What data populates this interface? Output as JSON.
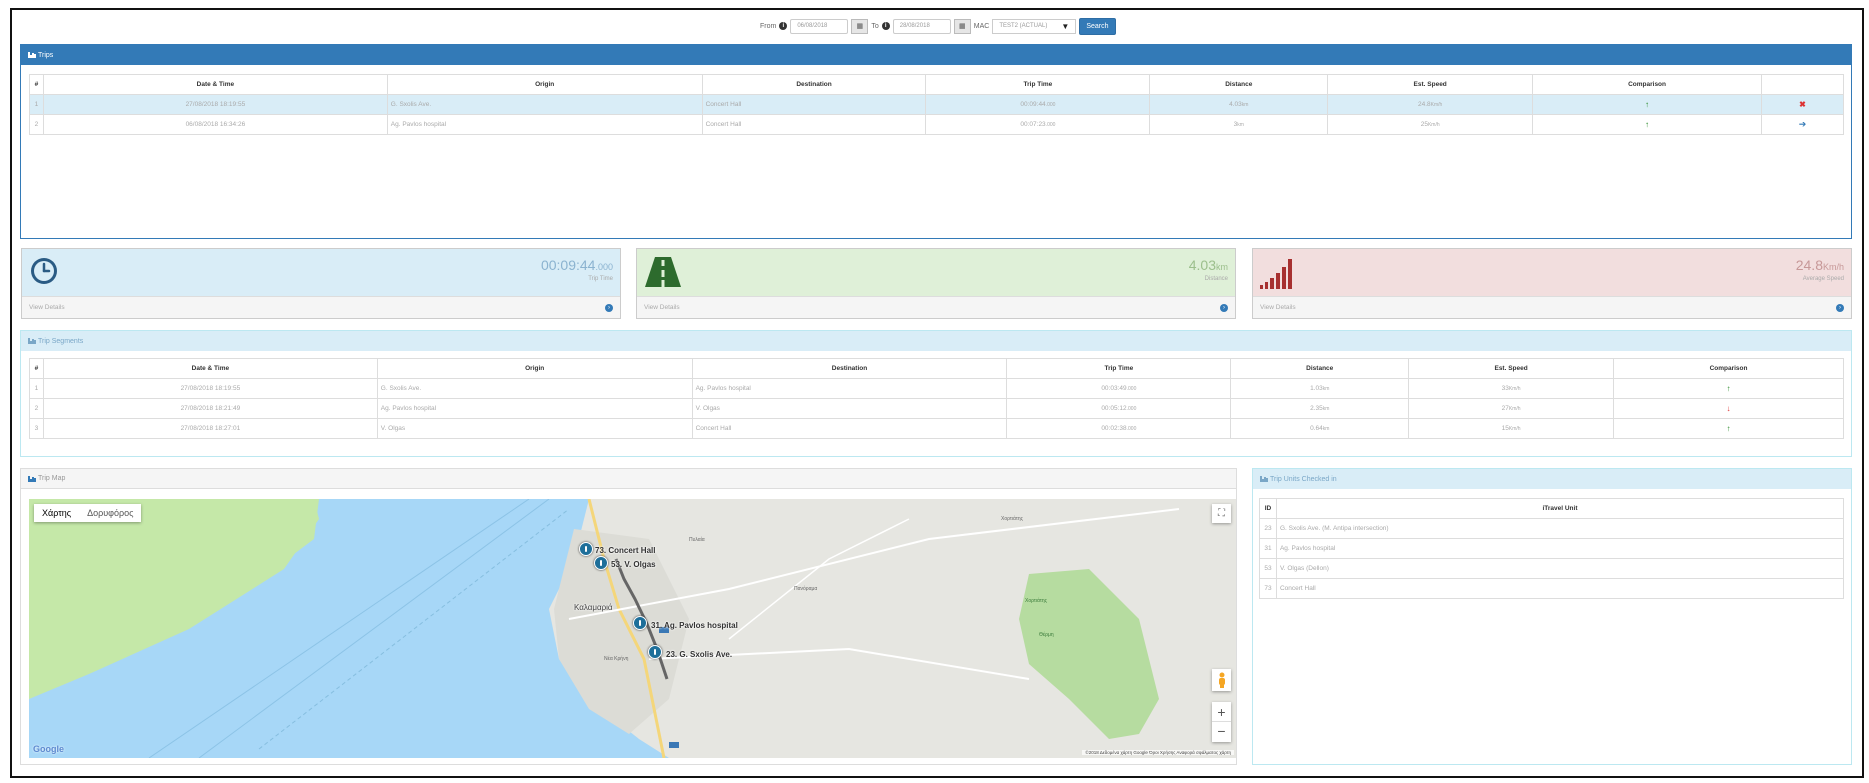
{
  "search": {
    "from_label": "From",
    "from_value": "06/08/2018",
    "to_label": "To",
    "to_value": "28/08/2018",
    "mac_label": "MAC",
    "mac_value": "TEST2 (ACTUAL)",
    "search_button": "Search"
  },
  "trips": {
    "title": "Trips",
    "headers": [
      "#",
      "Date & Time",
      "Origin",
      "Destination",
      "Trip Time",
      "Distance",
      "Est. Speed",
      "Comparison",
      ""
    ],
    "rows": [
      {
        "n": "1",
        "datetime": "27/08/2018 18:19:55",
        "origin": "G. Sxolis Ave.",
        "destination": "Concert Hall",
        "trip_time": "00:09:44",
        "trip_time_ms": ".000",
        "distance": "4.03",
        "distance_unit": "km",
        "speed": "24.8",
        "speed_unit": "Km/h",
        "comparison": "↑",
        "action": "✖"
      },
      {
        "n": "2",
        "datetime": "06/08/2018 16:34:26",
        "origin": "Ag. Pavlos hospital",
        "destination": "Concert Hall",
        "trip_time": "00:07:23",
        "trip_time_ms": ".000",
        "distance": "3",
        "distance_unit": "km",
        "speed": "25",
        "speed_unit": "Km/h",
        "comparison": "↑",
        "action": "➔"
      }
    ]
  },
  "stats": [
    {
      "value": "00:09:44",
      "value_unit": ".000",
      "label": "Trip Time",
      "footer": "View Details"
    },
    {
      "value": "4.03",
      "value_unit": "km",
      "label": "Distance",
      "footer": "View Details"
    },
    {
      "value": "24.8",
      "value_unit": "Km/h",
      "label": "Average Speed",
      "footer": "View Details"
    }
  ],
  "segments": {
    "title": "Trip Segments",
    "headers": [
      "#",
      "Date & Time",
      "Origin",
      "Destination",
      "Trip Time",
      "Distance",
      "Est. Speed",
      "Comparison"
    ],
    "rows": [
      {
        "n": "1",
        "datetime": "27/08/2018 18:19:55",
        "origin": "G. Sxolis Ave.",
        "destination": "Ag. Pavlos hospital",
        "trip_time": "00:03:49",
        "trip_time_ms": ".000",
        "distance": "1.03",
        "distance_unit": "km",
        "speed": "33",
        "speed_unit": "Km/h",
        "comparison": "↑"
      },
      {
        "n": "2",
        "datetime": "27/08/2018 18:21:49",
        "origin": "Ag. Pavlos hospital",
        "destination": "V. Olgas",
        "trip_time": "00:05:12",
        "trip_time_ms": ".000",
        "distance": "2.35",
        "distance_unit": "km",
        "speed": "27",
        "speed_unit": "Km/h",
        "comparison": "↓"
      },
      {
        "n": "3",
        "datetime": "27/08/2018 18:27:01",
        "origin": "V. Olgas",
        "destination": "Concert Hall",
        "trip_time": "00:02:38",
        "trip_time_ms": ".000",
        "distance": "0.64",
        "distance_unit": "km",
        "speed": "15",
        "speed_unit": "Km/h",
        "comparison": "↑"
      }
    ]
  },
  "map": {
    "title": "Trip Map",
    "type_map": "Χάρτης",
    "type_sat": "Δορυφόρος",
    "markers": [
      "73. Concert Hall",
      "53. V. Olgas",
      "31. Ag. Pavlos hospital",
      "23. G. Sxolis Ave."
    ],
    "city": "Καλαμαριά",
    "places": [
      "Χορτιάτης",
      "Πυλαία",
      "Πανόραμα",
      "Χορτιάτης",
      "Νέα Κρήνη",
      "Θέρμη"
    ],
    "google": "Google",
    "attribution": "©2018 Δεδομένα χάρτη Google   Όροι Χρήσης   Αναφορά σφάλματος χάρτη"
  },
  "units": {
    "title": "Trip Units Checked in",
    "headers": [
      "ID",
      "iTravel Unit"
    ],
    "rows": [
      {
        "id": "23",
        "name": "G. Sxolis Ave. (M. Antipa intersection)"
      },
      {
        "id": "31",
        "name": "Ag. Pavlos hospital"
      },
      {
        "id": "53",
        "name": "V. Olgas (Dellon)"
      },
      {
        "id": "73",
        "name": "Concert Hall"
      }
    ]
  },
  "colors": {
    "primary": "#337ab7",
    "info_bg": "#d9edf7",
    "success_bg": "#dff0d8",
    "danger_bg": "#f2dede",
    "up": "#2a8a2a",
    "down": "#dd3333"
  }
}
